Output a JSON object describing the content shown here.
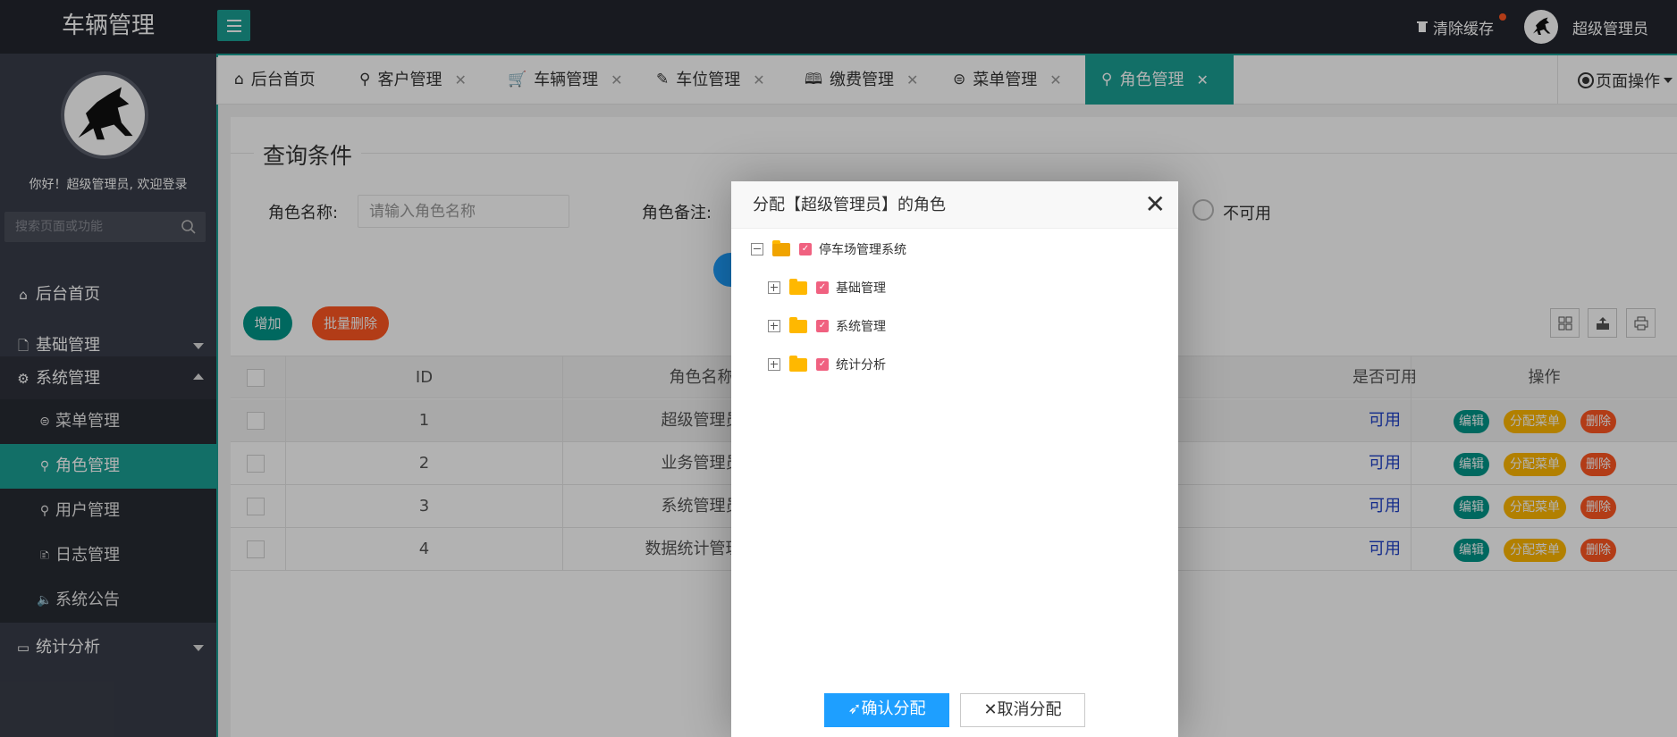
{
  "app": {
    "title": "车辆管理"
  },
  "header": {
    "clear_cache": "清除缓存",
    "username": "超级管理员"
  },
  "sidebar": {
    "welcome": "你好！超级管理员, 欢迎登录",
    "search_placeholder": "搜索页面或功能",
    "items": [
      {
        "label": "后台首页",
        "icon": "home-icon"
      },
      {
        "label": "基础管理",
        "icon": "file-icon"
      },
      {
        "label": "系统管理",
        "icon": "gear-icon"
      },
      {
        "label": "统计分析",
        "icon": "board-icon"
      }
    ],
    "sub_items": [
      {
        "label": "菜单管理",
        "icon": "menu-icon"
      },
      {
        "label": "角色管理",
        "icon": "user-icon"
      },
      {
        "label": "用户管理",
        "icon": "users-icon"
      },
      {
        "label": "日志管理",
        "icon": "log-icon"
      },
      {
        "label": "系统公告",
        "icon": "speaker-icon"
      }
    ]
  },
  "tabs": [
    {
      "label": "后台首页"
    },
    {
      "label": "客户管理"
    },
    {
      "label": "车辆管理"
    },
    {
      "label": "车位管理"
    },
    {
      "label": "缴费管理"
    },
    {
      "label": "菜单管理"
    },
    {
      "label": "角色管理"
    }
  ],
  "page_ops": "页面操作",
  "query": {
    "legend": "查询条件",
    "role_name_label": "角色名称:",
    "role_name_placeholder": "请输入角色名称",
    "role_remark_label": "角色备注:",
    "unavailable": "不可用"
  },
  "table": {
    "add": "增加",
    "batch_delete": "批量删除",
    "headers": {
      "id": "ID",
      "name": "角色名称",
      "available": "是否可用",
      "ops": "操作"
    },
    "rows": [
      {
        "id": "1",
        "name": "超级管理员",
        "available": "可用"
      },
      {
        "id": "2",
        "name": "业务管理员",
        "available": "可用"
      },
      {
        "id": "3",
        "name": "系统管理员",
        "available": "可用"
      },
      {
        "id": "4",
        "name": "数据统计管理员",
        "available": "可用"
      }
    ],
    "op_labels": {
      "edit": "编辑",
      "assign_menu": "分配菜单",
      "delete": "删除"
    }
  },
  "modal": {
    "title": "分配【超级管理员】的角色",
    "tree": [
      {
        "label": "停车场管理系统",
        "level": 0,
        "expanded": true,
        "checked": true
      },
      {
        "label": "基础管理",
        "level": 1,
        "expanded": false,
        "checked": true
      },
      {
        "label": "系统管理",
        "level": 1,
        "expanded": false,
        "checked": true
      },
      {
        "label": "统计分析",
        "level": 1,
        "expanded": false,
        "checked": true
      }
    ],
    "confirm": "确认分配",
    "cancel": "取消分配"
  },
  "colors": {
    "accent": "#1aa094",
    "header": "#23262e",
    "sidebar": "#393d49",
    "primary": "#1e9fff",
    "warm": "#ff5722",
    "yellow": "#ffb800"
  }
}
